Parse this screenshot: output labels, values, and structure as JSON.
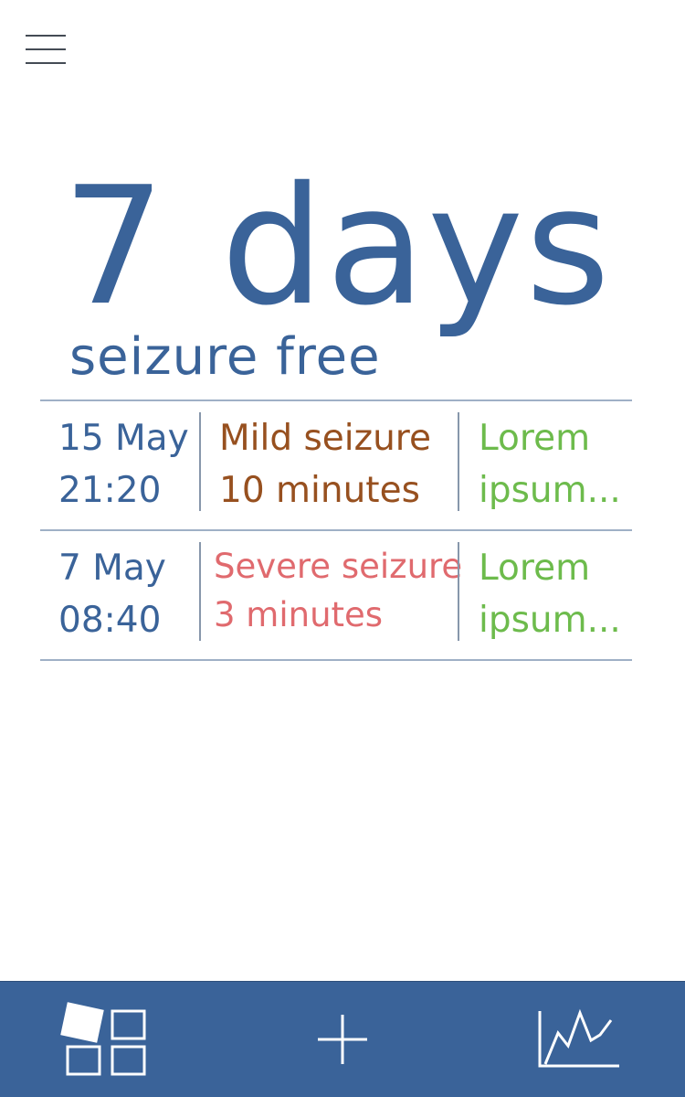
{
  "header": {
    "menu_icon": "hamburger-menu-icon"
  },
  "counter": {
    "value": "7 days",
    "subtitle": "seizure free"
  },
  "log": {
    "entries": [
      {
        "date": "15 May",
        "time": "21:20",
        "type": "Mild seizure",
        "duration": "10 minutes",
        "severity_color": "#97501f",
        "note_line1": "Lorem",
        "note_line2": "ipsum..."
      },
      {
        "date": "7 May",
        "time": "08:40",
        "type": "Severe seizure",
        "duration": "3 minutes",
        "severity_color": "#e06a6e",
        "note_line1": "Lorem",
        "note_line2": "ipsum..."
      }
    ]
  },
  "tabbar": {
    "items": [
      {
        "icon": "dashboard-icon"
      },
      {
        "icon": "add-icon"
      },
      {
        "icon": "chart-icon"
      }
    ]
  },
  "colors": {
    "primary": "#3a6399",
    "date_text": "#3a6399",
    "note_text": "#6dbb4c",
    "mild": "#97501f",
    "severe": "#e06a6e",
    "divider": "#9fb0c6"
  }
}
